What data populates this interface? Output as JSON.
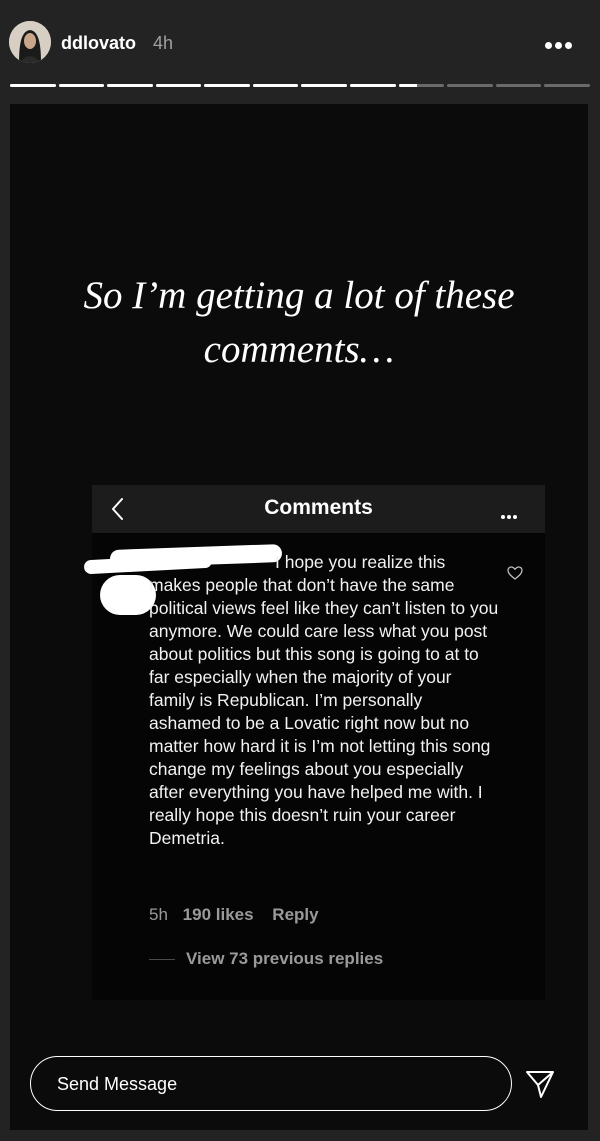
{
  "header": {
    "username": "ddlovato",
    "time": "4h",
    "progress": {
      "total_segments": 12,
      "completed_segments": 8,
      "current_segment_fraction": 0.4,
      "color_active": "#ffffff",
      "color_inactive": "#6a6a6a"
    }
  },
  "story": {
    "caption": "So I’m getting a lot of these comments…",
    "screenshot": {
      "title": "Comments",
      "comment": {
        "text": "I hope you realize this makes people that don’t have the same political views feel like they can’t listen to you anymore. We could care less what you post about politics but this song is going to at to far especially when the majority of your family is Republican. I’m personally ashamed to be a Lovatic right now but no matter how hard it is I’m not letting this song change my feelings about you especially after everything you have helped me with. I really hope this doesn’t ruin your career Demetria.",
        "age": "5h",
        "likes": "190 likes",
        "reply_label": "Reply",
        "view_replies": "View 73 previous replies"
      }
    }
  },
  "footer": {
    "message_placeholder": "Send Message"
  },
  "icons": {
    "more": "more-horizontal-icon",
    "back": "chevron-left-icon",
    "heart": "heart-outline-icon",
    "send": "paper-plane-icon"
  }
}
